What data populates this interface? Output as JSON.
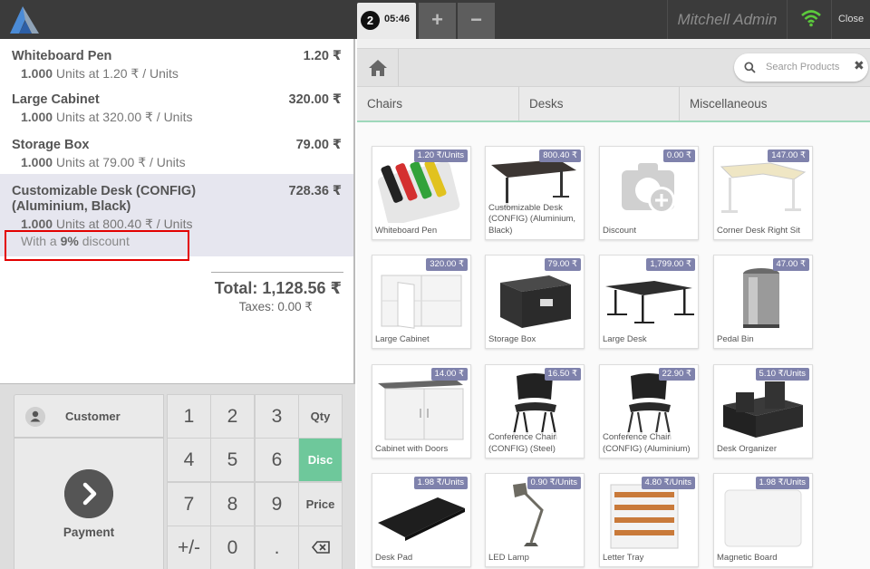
{
  "topbar": {
    "order_number": "2",
    "order_time": "05:46",
    "add_label": "+",
    "remove_label": "−",
    "user": "Mitchell Admin",
    "close_label": "Close"
  },
  "orderlines": [
    {
      "name": "Whiteboard Pen",
      "price": "1.20 ₹",
      "qty": "1.000",
      "info": " Units at 1.20 ₹ / Units"
    },
    {
      "name": "Large Cabinet",
      "price": "320.00 ₹",
      "qty": "1.000",
      "info": " Units at 320.00 ₹ / Units"
    },
    {
      "name": "Storage Box",
      "price": "79.00 ₹",
      "qty": "1.000",
      "info": " Units at 79.00 ₹ / Units"
    },
    {
      "name": "Customizable Desk (CONFIG) (Aluminium, Black)",
      "price": "728.36 ₹",
      "qty": "1.000",
      "info": " Units at 800.40 ₹ / Units",
      "discount_prefix": "With a ",
      "discount_value": "9%",
      "discount_suffix": " discount"
    }
  ],
  "summary": {
    "total": "Total: 1,128.56 ₹",
    "taxes": "Taxes: 0.00 ₹"
  },
  "pad": {
    "customer_label": "Customer",
    "payment_label": "Payment",
    "keys": [
      "1",
      "2",
      "3",
      "Qty",
      "4",
      "5",
      "6",
      "Disc",
      "7",
      "8",
      "9",
      "Price",
      "+/-",
      "0",
      ".",
      "⌫"
    ],
    "active_mode": "Disc"
  },
  "search": {
    "placeholder": "Search Products",
    "clear": "✖"
  },
  "categories": [
    "Chairs",
    "Desks",
    "Miscellaneous"
  ],
  "products": [
    {
      "name": "Whiteboard Pen",
      "price": "1.20 ₹/Units"
    },
    {
      "name": "Customizable Desk (CONFIG) (Aluminium, Black)",
      "price": "800.40 ₹"
    },
    {
      "name": "Discount",
      "price": "0.00 ₹"
    },
    {
      "name": "Corner Desk Right Sit",
      "price": "147.00 ₹"
    },
    {
      "name": "Large Cabinet",
      "price": "320.00 ₹"
    },
    {
      "name": "Storage Box",
      "price": "79.00 ₹"
    },
    {
      "name": "Large Desk",
      "price": "1,799.00 ₹"
    },
    {
      "name": "Pedal Bin",
      "price": "47.00 ₹"
    },
    {
      "name": "Cabinet with Doors",
      "price": "14.00 ₹"
    },
    {
      "name": "Conference Chair (CONFIG) (Steel)",
      "price": "16.50 ₹"
    },
    {
      "name": "Conference Chair (CONFIG) (Aluminium)",
      "price": "22.90 ₹"
    },
    {
      "name": "Desk Organizer",
      "price": "5.10 ₹/Units"
    },
    {
      "name": "Desk Pad",
      "price": "1.98 ₹/Units"
    },
    {
      "name": "LED Lamp",
      "price": "0.90 ₹/Units"
    },
    {
      "name": "Letter Tray",
      "price": "4.80 ₹/Units"
    },
    {
      "name": "Magnetic Board",
      "price": "1.98 ₹/Units"
    }
  ],
  "colors": {
    "accent": "#6ec89b",
    "price_tag": "#7f82ac",
    "highlight_box": "#e30000",
    "topbar": "#3b3b3b"
  }
}
